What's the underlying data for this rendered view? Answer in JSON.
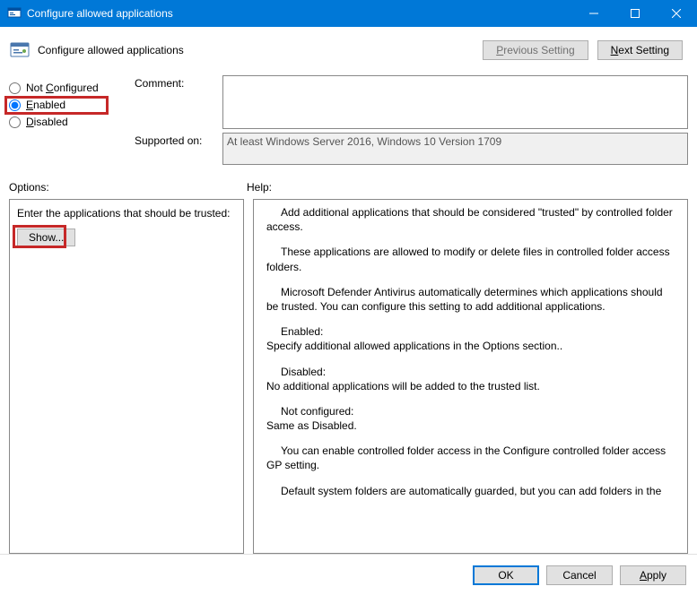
{
  "titlebar": {
    "title": "Configure allowed applications"
  },
  "header": {
    "title": "Configure allowed applications",
    "prev": "Previous Setting",
    "next": "Next Setting"
  },
  "radios": {
    "not_configured": "Not Configured",
    "enabled": "Enabled",
    "disabled": "Disabled",
    "selected": "enabled"
  },
  "form": {
    "comment_label": "Comment:",
    "comment_value": "",
    "supported_label": "Supported on:",
    "supported_value": "At least Windows Server 2016, Windows 10 Version 1709"
  },
  "sections": {
    "options_label": "Options:",
    "help_label": "Help:"
  },
  "options_panel": {
    "prompt": "Enter the applications that should be trusted:",
    "show_label": "Show..."
  },
  "help_text": {
    "p1": "Add additional applications that should be considered \"trusted\" by controlled folder access.",
    "p2": "These applications are allowed to modify or delete files in controlled folder access folders.",
    "p3": "Microsoft Defender Antivirus automatically determines which applications should be trusted. You can configure this setting to add additional applications.",
    "p4a": "Enabled:",
    "p4b": "Specify additional allowed applications in the Options section..",
    "p5a": "Disabled:",
    "p5b": "No additional applications will be added to the trusted list.",
    "p6a": "Not configured:",
    "p6b": "Same as Disabled.",
    "p7": "You can enable controlled folder access in the Configure controlled folder access GP setting.",
    "p8": "Default system folders are automatically guarded, but you can add folders in the"
  },
  "buttons": {
    "ok": "OK",
    "cancel": "Cancel",
    "apply": "Apply"
  }
}
